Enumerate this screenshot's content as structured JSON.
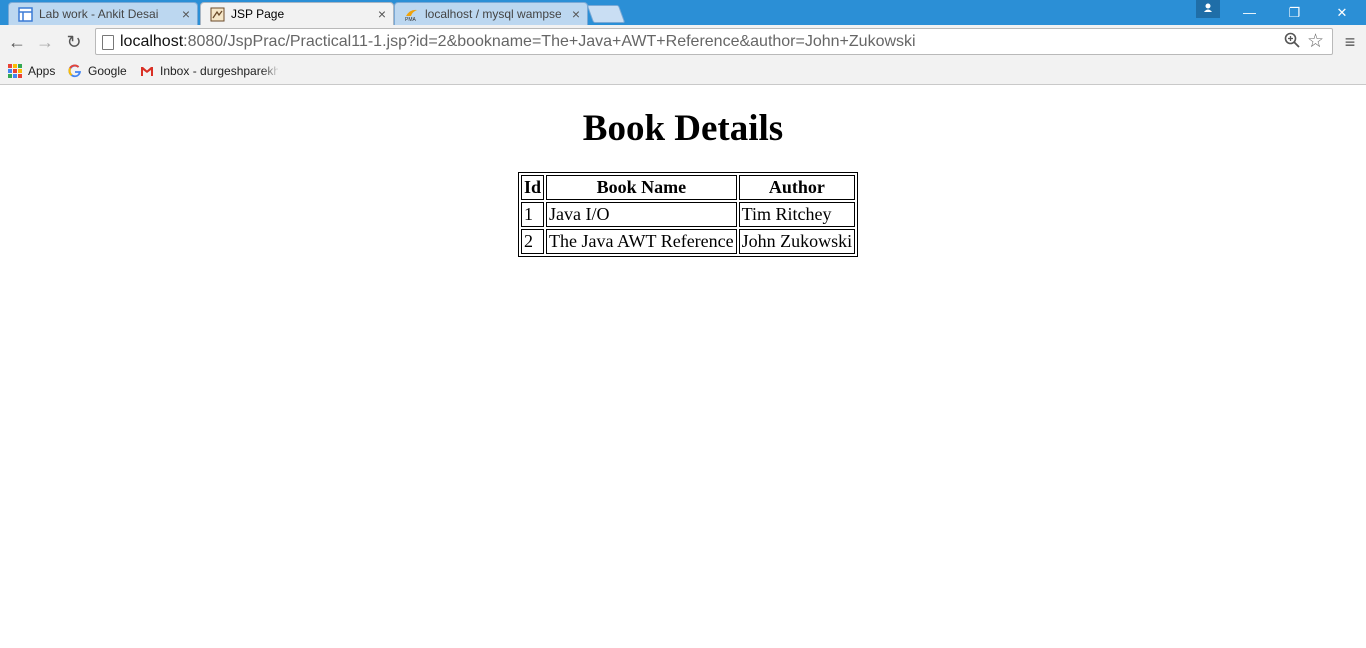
{
  "browser": {
    "tabs": [
      {
        "title": "Lab work - Ankit Desai",
        "close": "×"
      },
      {
        "title": "JSP Page",
        "close": "×"
      },
      {
        "title": "localhost / mysql wampserver",
        "close": "×"
      }
    ],
    "window_controls": {
      "minimize": "—",
      "restore": "❐",
      "close": "✕"
    },
    "nav": {
      "back": "←",
      "forward": "→",
      "reload": "↻"
    },
    "address": {
      "host": "localhost",
      "rest": ":8080/JspPrac/Practical11-1.jsp?id=2&bookname=The+Java+AWT+Reference&author=John+Zukowski"
    },
    "bookmarks": [
      {
        "label": "Apps"
      },
      {
        "label": "Google"
      },
      {
        "label": "Inbox - durgeshparekh"
      }
    ],
    "colors": {
      "titlebar": "#2b8fd6",
      "toolbar": "#f2f2f2"
    }
  },
  "page": {
    "heading": "Book Details",
    "table": {
      "headers": [
        "Id",
        "Book Name",
        "Author"
      ],
      "rows": [
        [
          "1",
          "Java I/O",
          "Tim Ritchey"
        ],
        [
          "2",
          "The Java AWT Reference",
          "John Zukowski"
        ]
      ]
    }
  }
}
